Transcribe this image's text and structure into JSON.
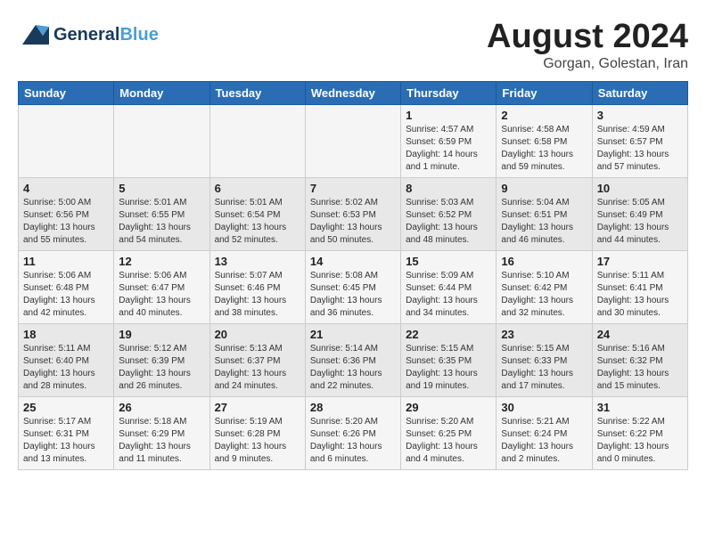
{
  "header": {
    "logo_general": "General",
    "logo_blue": "Blue",
    "month_year": "August 2024",
    "location": "Gorgan, Golestan, Iran"
  },
  "days_of_week": [
    "Sunday",
    "Monday",
    "Tuesday",
    "Wednesday",
    "Thursday",
    "Friday",
    "Saturday"
  ],
  "weeks": [
    [
      {
        "day": "",
        "info": ""
      },
      {
        "day": "",
        "info": ""
      },
      {
        "day": "",
        "info": ""
      },
      {
        "day": "",
        "info": ""
      },
      {
        "day": "1",
        "info": "Sunrise: 4:57 AM\nSunset: 6:59 PM\nDaylight: 14 hours\nand 1 minute."
      },
      {
        "day": "2",
        "info": "Sunrise: 4:58 AM\nSunset: 6:58 PM\nDaylight: 13 hours\nand 59 minutes."
      },
      {
        "day": "3",
        "info": "Sunrise: 4:59 AM\nSunset: 6:57 PM\nDaylight: 13 hours\nand 57 minutes."
      }
    ],
    [
      {
        "day": "4",
        "info": "Sunrise: 5:00 AM\nSunset: 6:56 PM\nDaylight: 13 hours\nand 55 minutes."
      },
      {
        "day": "5",
        "info": "Sunrise: 5:01 AM\nSunset: 6:55 PM\nDaylight: 13 hours\nand 54 minutes."
      },
      {
        "day": "6",
        "info": "Sunrise: 5:01 AM\nSunset: 6:54 PM\nDaylight: 13 hours\nand 52 minutes."
      },
      {
        "day": "7",
        "info": "Sunrise: 5:02 AM\nSunset: 6:53 PM\nDaylight: 13 hours\nand 50 minutes."
      },
      {
        "day": "8",
        "info": "Sunrise: 5:03 AM\nSunset: 6:52 PM\nDaylight: 13 hours\nand 48 minutes."
      },
      {
        "day": "9",
        "info": "Sunrise: 5:04 AM\nSunset: 6:51 PM\nDaylight: 13 hours\nand 46 minutes."
      },
      {
        "day": "10",
        "info": "Sunrise: 5:05 AM\nSunset: 6:49 PM\nDaylight: 13 hours\nand 44 minutes."
      }
    ],
    [
      {
        "day": "11",
        "info": "Sunrise: 5:06 AM\nSunset: 6:48 PM\nDaylight: 13 hours\nand 42 minutes."
      },
      {
        "day": "12",
        "info": "Sunrise: 5:06 AM\nSunset: 6:47 PM\nDaylight: 13 hours\nand 40 minutes."
      },
      {
        "day": "13",
        "info": "Sunrise: 5:07 AM\nSunset: 6:46 PM\nDaylight: 13 hours\nand 38 minutes."
      },
      {
        "day": "14",
        "info": "Sunrise: 5:08 AM\nSunset: 6:45 PM\nDaylight: 13 hours\nand 36 minutes."
      },
      {
        "day": "15",
        "info": "Sunrise: 5:09 AM\nSunset: 6:44 PM\nDaylight: 13 hours\nand 34 minutes."
      },
      {
        "day": "16",
        "info": "Sunrise: 5:10 AM\nSunset: 6:42 PM\nDaylight: 13 hours\nand 32 minutes."
      },
      {
        "day": "17",
        "info": "Sunrise: 5:11 AM\nSunset: 6:41 PM\nDaylight: 13 hours\nand 30 minutes."
      }
    ],
    [
      {
        "day": "18",
        "info": "Sunrise: 5:11 AM\nSunset: 6:40 PM\nDaylight: 13 hours\nand 28 minutes."
      },
      {
        "day": "19",
        "info": "Sunrise: 5:12 AM\nSunset: 6:39 PM\nDaylight: 13 hours\nand 26 minutes."
      },
      {
        "day": "20",
        "info": "Sunrise: 5:13 AM\nSunset: 6:37 PM\nDaylight: 13 hours\nand 24 minutes."
      },
      {
        "day": "21",
        "info": "Sunrise: 5:14 AM\nSunset: 6:36 PM\nDaylight: 13 hours\nand 22 minutes."
      },
      {
        "day": "22",
        "info": "Sunrise: 5:15 AM\nSunset: 6:35 PM\nDaylight: 13 hours\nand 19 minutes."
      },
      {
        "day": "23",
        "info": "Sunrise: 5:15 AM\nSunset: 6:33 PM\nDaylight: 13 hours\nand 17 minutes."
      },
      {
        "day": "24",
        "info": "Sunrise: 5:16 AM\nSunset: 6:32 PM\nDaylight: 13 hours\nand 15 minutes."
      }
    ],
    [
      {
        "day": "25",
        "info": "Sunrise: 5:17 AM\nSunset: 6:31 PM\nDaylight: 13 hours\nand 13 minutes."
      },
      {
        "day": "26",
        "info": "Sunrise: 5:18 AM\nSunset: 6:29 PM\nDaylight: 13 hours\nand 11 minutes."
      },
      {
        "day": "27",
        "info": "Sunrise: 5:19 AM\nSunset: 6:28 PM\nDaylight: 13 hours\nand 9 minutes."
      },
      {
        "day": "28",
        "info": "Sunrise: 5:20 AM\nSunset: 6:26 PM\nDaylight: 13 hours\nand 6 minutes."
      },
      {
        "day": "29",
        "info": "Sunrise: 5:20 AM\nSunset: 6:25 PM\nDaylight: 13 hours\nand 4 minutes."
      },
      {
        "day": "30",
        "info": "Sunrise: 5:21 AM\nSunset: 6:24 PM\nDaylight: 13 hours\nand 2 minutes."
      },
      {
        "day": "31",
        "info": "Sunrise: 5:22 AM\nSunset: 6:22 PM\nDaylight: 13 hours\nand 0 minutes."
      }
    ]
  ]
}
